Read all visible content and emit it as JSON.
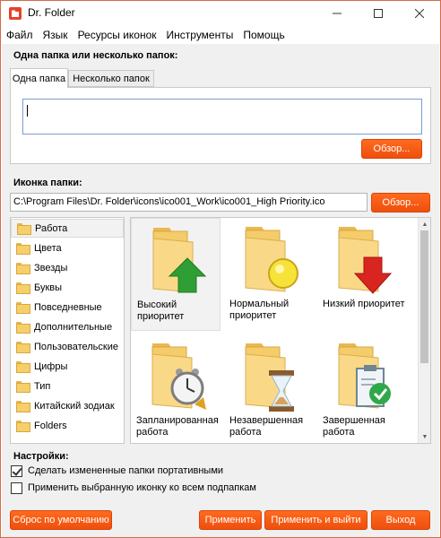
{
  "window": {
    "title": "Dr. Folder",
    "controls": {
      "minimize": "—",
      "maximize": "☐",
      "close": "✕"
    }
  },
  "menu": [
    "Файл",
    "Язык",
    "Ресурсы иконок",
    "Инструменты",
    "Помощь"
  ],
  "folder_section": {
    "label": "Одна папка или несколько папок:",
    "tabs": [
      "Одна папка",
      "Несколько папок"
    ],
    "active_tab": "Одна папка",
    "input_value": "",
    "browse_label": "Обзор..."
  },
  "icon_section": {
    "label": "Иконка папки:",
    "path": "C:\\Program Files\\Dr. Folder\\icons\\ico001_Work\\ico001_High Priority.ico",
    "browse_label": "Обзор..."
  },
  "categories": [
    "Работа",
    "Цвета",
    "Звезды",
    "Буквы",
    "Повседневные",
    "Дополнительные",
    "Пользовательские",
    "Цифры",
    "Тип",
    "Китайский зодиак",
    "Folders"
  ],
  "selected_category": "Работа",
  "icons": [
    {
      "label": "Высокий приоритет",
      "icon": "folder-green-arrow-up-icon",
      "selected": true
    },
    {
      "label": "Нормальный приоритет",
      "icon": "folder-yellow-circle-icon",
      "selected": false
    },
    {
      "label": "Низкий приоритет",
      "icon": "folder-red-arrow-down-icon",
      "selected": false
    },
    {
      "label": "Запланированная работа",
      "icon": "folder-alarm-clock-icon",
      "selected": false
    },
    {
      "label": "Незавершенная работа",
      "icon": "folder-hourglass-icon",
      "selected": false
    },
    {
      "label": "Завершенная работа",
      "icon": "folder-clipboard-check-icon",
      "selected": false
    }
  ],
  "settings": {
    "label": "Настройки:",
    "options": [
      {
        "label": "Сделать измененные папки портативными",
        "checked": true
      },
      {
        "label": "Применить выбранную иконку ко всем подпапкам",
        "checked": false
      }
    ]
  },
  "buttons": {
    "reset": "Сброс по умолчанию",
    "apply": "Применить",
    "apply_exit": "Применить и выйти",
    "exit": "Выход"
  },
  "colors": {
    "accent": "#f15a18",
    "window_border": "#d46b4a",
    "folder": "#f6cf6a"
  }
}
